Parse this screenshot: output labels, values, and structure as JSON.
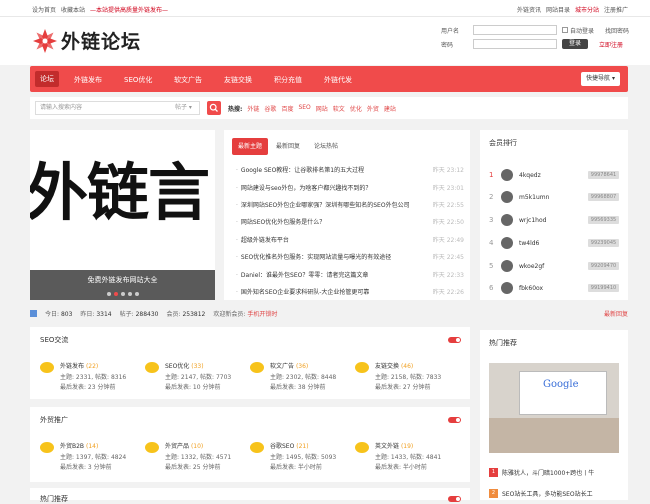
{
  "topbar": {
    "set_home": "设为首页",
    "favorite": "收藏本站",
    "notice": "—本站提供高质量外链发布—",
    "links": [
      "外链资讯",
      "网站目录",
      "城市分站",
      "注册推广"
    ],
    "red_link_index": 2
  },
  "logo": {
    "text": "外链论坛"
  },
  "login": {
    "username_label": "用户名",
    "password_label": "密码",
    "auto_login": "自动登录",
    "forgot": "找回密码",
    "submit": "登录",
    "register": "立即注册"
  },
  "nav": {
    "items": [
      "论坛",
      "外链发布",
      "SEO优化",
      "软文广告",
      "友链交换",
      "积分充值",
      "外链代发"
    ],
    "active": 0,
    "quick": "快捷导航"
  },
  "search": {
    "placeholder": "请输入搜索内容",
    "type": "帖子",
    "hot_label": "热搜:",
    "hot": [
      "外链",
      "谷歌",
      "百度",
      "SEO",
      "网站",
      "软文",
      "优化",
      "外贸",
      "建站"
    ]
  },
  "slider": {
    "image_text": "外链言",
    "caption": "免费外链发布网站大全",
    "dots": 5,
    "active_dot": 1
  },
  "topics": {
    "tabs": [
      "最新主题",
      "最新回复",
      "论坛热帖"
    ],
    "active": 0,
    "items": [
      {
        "title": "Google SEO教程：让谷歌排名第1的五大过程",
        "date": "昨天 23:12"
      },
      {
        "title": "网站建设与seo外包，为啥客户都兴趣找不到的？",
        "date": "昨天 23:01"
      },
      {
        "title": "深圳网站SEO外包企业哪家强？深圳有哪些知名的SEO外包公司",
        "date": "昨天 22:55"
      },
      {
        "title": "网站SEO优化外包服务是什么？",
        "date": "昨天 22:50"
      },
      {
        "title": "超级外链发布平台",
        "date": "昨天 22:49"
      },
      {
        "title": "SEO优化推名外包服务：实现网站流量与曝光的有效途径",
        "date": "昨天 22:45"
      },
      {
        "title": "Daniel：谁最外包SEO？零零：请者完这篇文章",
        "date": "昨天 22:33"
      },
      {
        "title": "国外知名SEO企业要求科研队-大企业抢管更可靠",
        "date": "昨天 22:26"
      }
    ]
  },
  "ranking": {
    "title": "会员排行",
    "members": [
      {
        "rank": "1",
        "name": "4kqedz",
        "score": "99978641"
      },
      {
        "rank": "2",
        "name": "m5k1umn",
        "score": "99968807"
      },
      {
        "rank": "3",
        "name": "wrjc1hod",
        "score": "99569335"
      },
      {
        "rank": "4",
        "name": "tw4ld6",
        "score": "99239045"
      },
      {
        "rank": "5",
        "name": "wkoe2gf",
        "score": "99209470"
      },
      {
        "rank": "6",
        "name": "fbk60ox",
        "score": "99199410"
      }
    ]
  },
  "stats": {
    "today_label": "今日:",
    "today": "803",
    "yesterday_label": "昨日:",
    "yesterday": "3314",
    "posts_label": "帖子:",
    "posts": "288430",
    "members_label": "会员:",
    "members": "253812",
    "welcome_label": "欢迎新会员:",
    "welcome": "手机开锁时",
    "newest": "最新回复"
  },
  "sections": [
    {
      "title": "SEO交流",
      "forums": [
        {
          "name": "外链发布",
          "count": "(22)",
          "stats": "主题: 2331, 帖数: 8316",
          "last": "最后发表: 23 分钟前"
        },
        {
          "name": "SEO优化",
          "count": "(33)",
          "stats": "主题: 2147, 帖数: 7703",
          "last": "最后发表: 10 分钟前"
        },
        {
          "name": "软文广告",
          "count": "(36)",
          "stats": "主题: 2302, 帖数: 8448",
          "last": "最后发表: 38 分钟前"
        },
        {
          "name": "友链交换",
          "count": "(46)",
          "stats": "主题: 2158, 帖数: 7833",
          "last": "最后发表: 27 分钟前"
        }
      ]
    },
    {
      "title": "外贸推广",
      "forums": [
        {
          "name": "外贸B2B",
          "count": "(14)",
          "stats": "主题: 1397, 帖数: 4824",
          "last": "最后发表: 3 分钟前"
        },
        {
          "name": "外贸产品",
          "count": "(10)",
          "stats": "主题: 1332, 帖数: 4571",
          "last": "最后发表: 25 分钟前"
        },
        {
          "name": "谷歌SEO",
          "count": "(21)",
          "stats": "主题: 1495, 帖数: 5093",
          "last": "最后发表: 半小时前"
        },
        {
          "name": "英文外链",
          "count": "(19)",
          "stats": "主题: 1433, 帖数: 4841",
          "last": "最后发表: 半小时前"
        }
      ]
    },
    {
      "title": "热门推荐",
      "forums": []
    }
  ],
  "hot_recommend": {
    "title": "热门推荐",
    "image_text": "Google",
    "items": [
      "陈雅犹人，斗门暗1000+跨也丨牛",
      "SEO站长工具，多功能SEO站长工"
    ]
  },
  "colors": {
    "accent": "#f04b4b",
    "accent_dark": "#c22c2c",
    "bubble": "#f7c31b"
  }
}
